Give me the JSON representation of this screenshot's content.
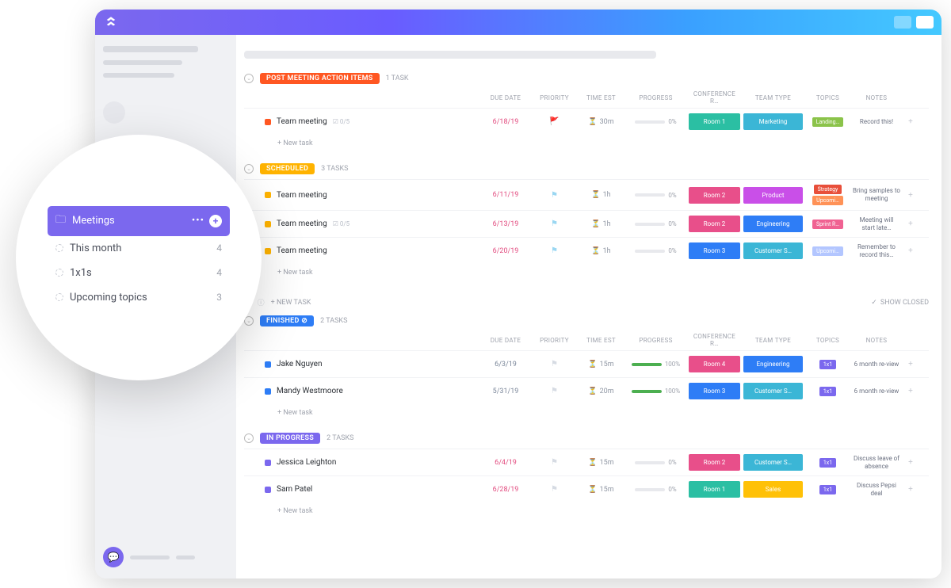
{
  "popover": {
    "title": "Meetings",
    "items": [
      {
        "label": "This month",
        "count": 4
      },
      {
        "label": "1x1s",
        "count": 4
      },
      {
        "label": "Upcoming topics",
        "count": 3
      }
    ]
  },
  "columns": [
    "DUE DATE",
    "PRIORITY",
    "TIME EST",
    "PROGRESS",
    "CONFERENCE R…",
    "TEAM TYPE",
    "TOPICS",
    "NOTES",
    ""
  ],
  "section2": {
    "newtask": "+ NEW TASK",
    "showclosed": "SHOW CLOSED"
  },
  "groups": [
    {
      "status": "POST MEETING ACTION ITEMS",
      "status_color": "#ff5722",
      "task_count": "1 TASK",
      "rows": [
        {
          "sq": "#ff5722",
          "name": "Team meeting",
          "sub": "0/5",
          "date": "6/18/19",
          "flag": "🚩",
          "flag_color": "#e53935",
          "est": "30m",
          "progress": 0,
          "room": "Room 1",
          "room_c": "#2bbfa3",
          "team": "Marketing",
          "team_c": "#3bb6d6",
          "topics": [
            {
              "t": "Landing…",
              "c": "#8bc34a"
            }
          ],
          "note": "Record this!"
        }
      ]
    },
    {
      "status": "SCHEDULED",
      "status_color": "#ffb300",
      "task_count": "3 TASKS",
      "rows": [
        {
          "sq": "#ffb300",
          "name": "Team meeting",
          "date": "6/11/19",
          "flag": "⚑",
          "flag_color": "#9ad7f2",
          "est": "1h",
          "progress": 0,
          "room": "Room 2",
          "room_c": "#e84f8a",
          "team": "Product",
          "team_c": "#c94fe8",
          "topics": [
            {
              "t": "Strategy",
              "c": "#e84f3a"
            },
            {
              "t": "Upcomi…",
              "c": "#ff9257"
            }
          ],
          "note": "Bring samples to meeting"
        },
        {
          "sq": "#ffb300",
          "name": "Team meeting",
          "sub": "0/5",
          "date": "6/13/19",
          "flag": "⚑",
          "flag_color": "#9ad7f2",
          "est": "1h",
          "progress": 0,
          "room": "Room 2",
          "room_c": "#e84f8a",
          "team": "Engineering",
          "team_c": "#2e7df6",
          "topics": [
            {
              "t": "Sprint R…",
              "c": "#f06292"
            }
          ],
          "note": "Meeting will start late…"
        },
        {
          "sq": "#ffb300",
          "name": "Team meeting",
          "date": "6/20/19",
          "flag": "⚑",
          "flag_color": "#9ad7f2",
          "est": "1h",
          "progress": 0,
          "room": "Room 3",
          "room_c": "#2e7df6",
          "team": "Customer S…",
          "team_c": "#3bb6d6",
          "topics": [
            {
              "t": "Upcomi…",
              "c": "#b3c6ff"
            }
          ],
          "note": "Remember to record this…"
        }
      ]
    }
  ],
  "groups2": [
    {
      "status": "FINISHED",
      "status_color": "#2e7df6",
      "task_count": "2 TASKS",
      "check": true,
      "rows": [
        {
          "sq": "#2e7df6",
          "name": "Jake Nguyen",
          "date": "6/3/19",
          "date_ok": true,
          "flag": "⚑",
          "flag_color": "#d6dbe3",
          "est": "15m",
          "progress": 100,
          "room": "Room 4",
          "room_c": "#e84f8a",
          "team": "Engineering",
          "team_c": "#2e7df6",
          "topics": [
            {
              "t": "1x1",
              "c": "#7b68ee"
            }
          ],
          "note": "6 month re-view"
        },
        {
          "sq": "#2e7df6",
          "name": "Mandy Westmoore",
          "date": "5/31/19",
          "date_ok": true,
          "flag": "⚑",
          "flag_color": "#d6dbe3",
          "est": "20m",
          "progress": 100,
          "room": "Room 3",
          "room_c": "#2e7df6",
          "team": "Customer S…",
          "team_c": "#3bb6d6",
          "topics": [
            {
              "t": "1x1",
              "c": "#7b68ee"
            }
          ],
          "note": "6 month re-view"
        }
      ]
    },
    {
      "status": "IN PROGRESS",
      "status_color": "#7b68ee",
      "task_count": "2 TASKS",
      "rows": [
        {
          "sq": "#7b68ee",
          "name": "Jessica Leighton",
          "date": "6/4/19",
          "flag": "⚑",
          "flag_color": "#d6dbe3",
          "est": "15m",
          "progress": 0,
          "room": "Room 2",
          "room_c": "#e84f8a",
          "team": "Customer S…",
          "team_c": "#3bb6d6",
          "topics": [
            {
              "t": "1x1",
              "c": "#7b68ee"
            }
          ],
          "note": "Discuss leave of absence"
        },
        {
          "sq": "#7b68ee",
          "name": "Sam Patel",
          "date": "6/28/19",
          "flag": "⚑",
          "flag_color": "#d6dbe3",
          "est": "15m",
          "progress": 0,
          "room": "Room 1",
          "room_c": "#2bbfa3",
          "team": "Sales",
          "team_c": "#ffc107",
          "topics": [
            {
              "t": "1x1",
              "c": "#7b68ee"
            }
          ],
          "note": "Discuss Pepsi deal"
        }
      ]
    }
  ],
  "newtask": "+ New task"
}
